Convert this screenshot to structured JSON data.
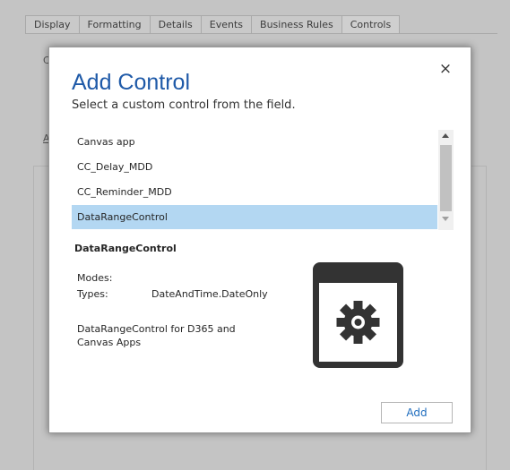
{
  "background": {
    "tabs": [
      "Display",
      "Formatting",
      "Details",
      "Events",
      "Business Rules",
      "Controls"
    ],
    "active_tab_index": 5,
    "letters": [
      "C",
      "A"
    ]
  },
  "dialog": {
    "title": "Add Control",
    "subtitle": "Select a custom control from the field.",
    "close_glyph": "×",
    "list": {
      "items": [
        "Canvas app",
        "CC_Delay_MDD",
        "CC_Reminder_MDD",
        "DataRangeControl"
      ],
      "selected_index": 3
    },
    "details": {
      "name": "DataRangeControl",
      "modes_label": "Modes:",
      "modes_value": "",
      "types_label": "Types:",
      "types_value": "DateAndTime.DateOnly",
      "description": "DataRangeControl for D365 and Canvas Apps",
      "icon": "gear-window-icon"
    },
    "add_label": "Add"
  },
  "colors": {
    "accent": "#1f5aa8",
    "selection": "#b3d7f2",
    "icon_dark": "#333333"
  }
}
